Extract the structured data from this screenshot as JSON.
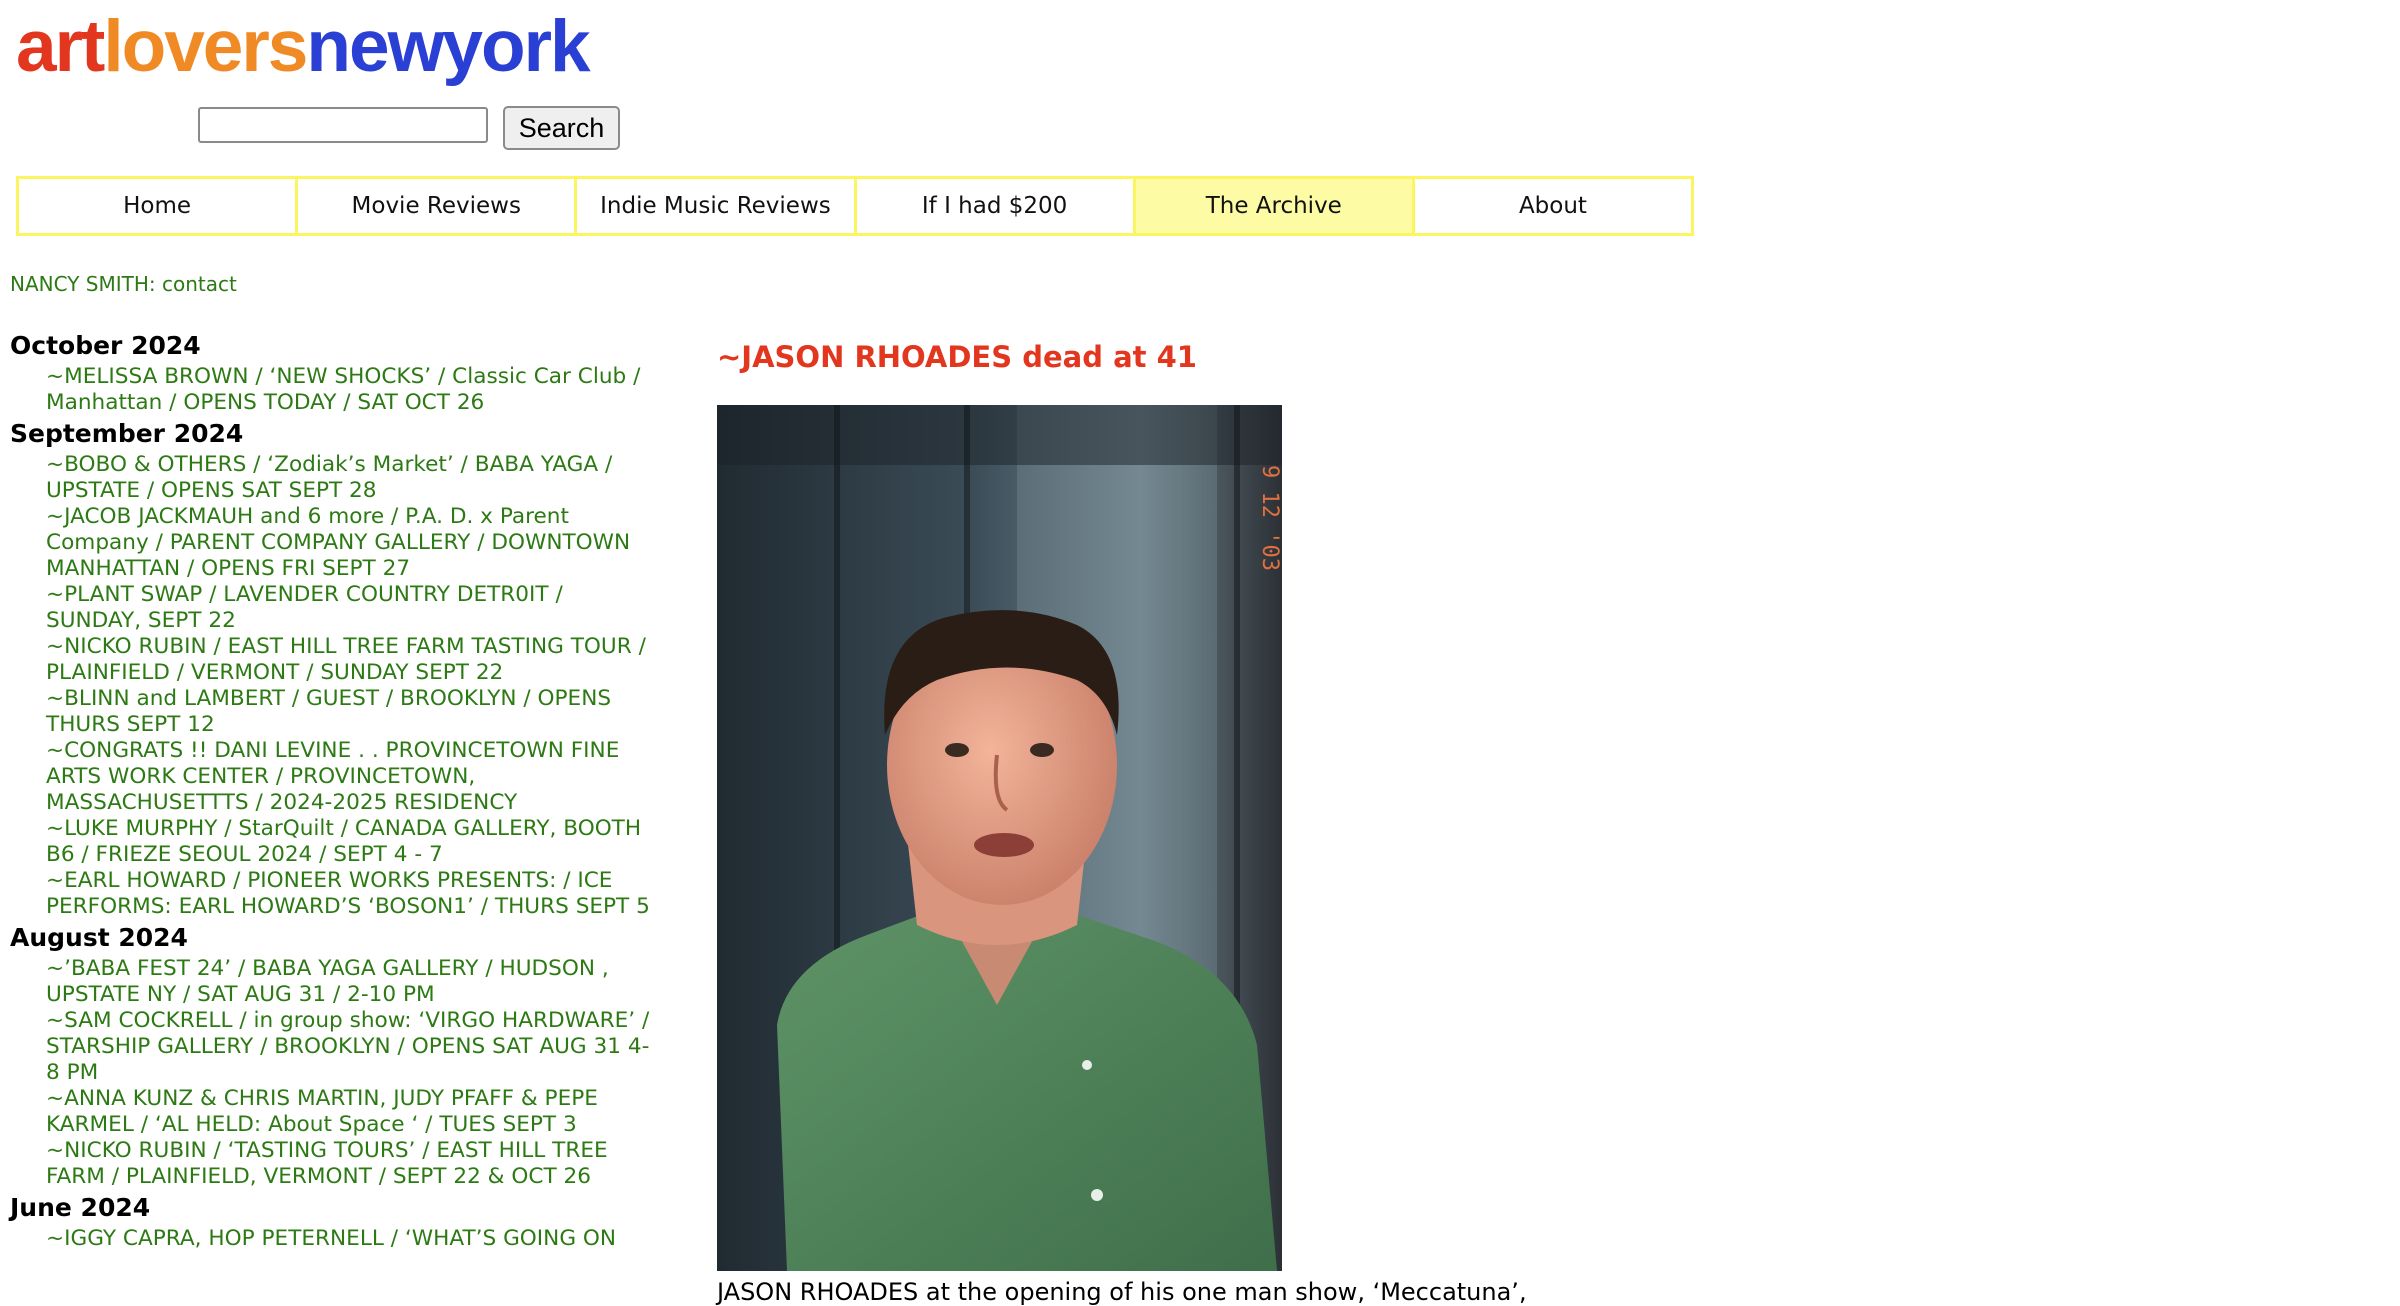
{
  "logo": {
    "art": "art",
    "lovers": "lovers",
    "newyork": "newyork",
    "colors": {
      "art": "#e2361e",
      "lovers": "#f08a24",
      "newyork": "#2a3fd4"
    }
  },
  "search": {
    "value": "",
    "placeholder": "",
    "button_label": "Search"
  },
  "nav": {
    "items": [
      {
        "label": "Home"
      },
      {
        "label": "Movie Reviews"
      },
      {
        "label": "Indie Music Reviews"
      },
      {
        "label": "If I had $200"
      },
      {
        "label": "The Archive",
        "active": true
      },
      {
        "label": "About"
      }
    ],
    "border_color": "#fbf560",
    "active_color": "#fdfba4"
  },
  "contact": {
    "prefix": "NANCY SMITH: ",
    "link": "contact"
  },
  "sidebar": {
    "link_color": "#2d7a15",
    "months": [
      {
        "label": "October 2024",
        "posts": [
          "~MELISSA BROWN / ‘NEW SHOCKS’ / Classic Car Club / Manhattan / OPENS TODAY / SAT OCT 26"
        ]
      },
      {
        "label": "September 2024",
        "posts": [
          "~BOBO & OTHERS / ‘Zodiak’s Market’ / BABA YAGA / UPSTATE / OPENS SAT SEPT 28",
          "~JACOB JACKMAUH and 6 more / P.A. D. x Parent Company / PARENT COMPANY GALLERY / DOWNTOWN MANHATTAN / OPENS FRI SEPT 27",
          "~PLANT SWAP / LAVENDER COUNTRY DETR0IT / SUNDAY, SEPT 22",
          "~NICKO RUBIN / EAST HILL TREE FARM TASTING TOUR / PLAINFIELD / VERMONT / SUNDAY SEPT 22",
          "~BLINN and LAMBERT / GUEST / BROOKLYN / OPENS THURS SEPT 12",
          "~CONGRATS !! DANI LEVINE . . PROVINCETOWN FINE ARTS WORK CENTER / PROVINCETOWN, MASSACHUSETTTS / 2024-2025 RESIDENCY",
          "~LUKE MURPHY / StarQuilt / CANADA GALLERY, BOOTH B6 / FRIEZE SEOUL 2024 / SEPT 4 - 7",
          "~EARL HOWARD / PIONEER WORKS PRESENTS: / ICE PERFORMS: EARL HOWARD’S ‘BOSON1’ / THURS SEPT 5"
        ]
      },
      {
        "label": "August 2024",
        "posts": [
          "~’BABA FEST 24’ / BABA YAGA GALLERY / HUDSON , UPSTATE NY / SAT AUG 31 / 2-10 PM",
          "~SAM COCKRELL / in group show: ‘VIRGO HARDWARE’ / STARSHIP GALLERY / BROOKLYN / OPENS SAT AUG 31 4-8 PM",
          "~ANNA KUNZ & CHRIS MARTIN, JUDY PFAFF & PEPE KARMEL / ‘AL HELD: About Space ‘ / TUES SEPT 3",
          "~NICKO RUBIN / ‘TASTING TOURS’ / EAST HILL TREE FARM / PLAINFIELD, VERMONT / SEPT 22 & OCT 26"
        ]
      },
      {
        "label": "June 2024",
        "posts": [
          "~IGGY CAPRA, HOP PETERNELL / ‘WHAT’S GOING ON"
        ]
      }
    ]
  },
  "article": {
    "title": "~JASON RHOADES dead at 41",
    "title_color": "#e2361e",
    "photo_stamp": "9 12 '03",
    "caption": "JASON RHOADES at the opening of his one man show, ‘Meccatuna’,"
  }
}
